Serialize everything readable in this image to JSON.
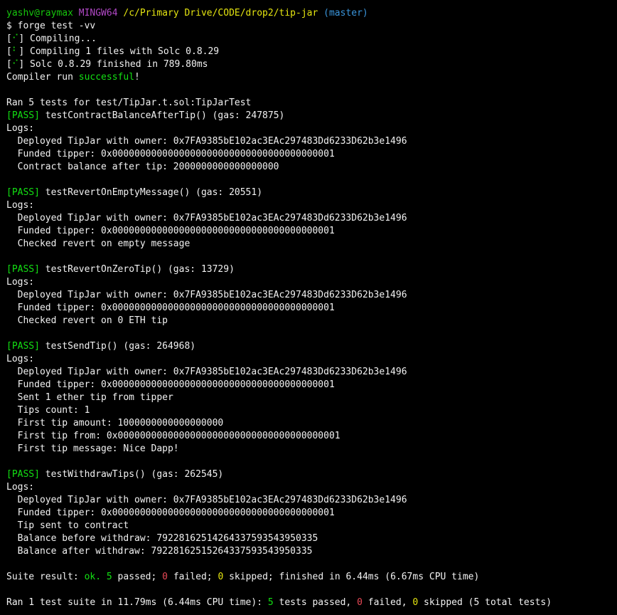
{
  "lines": [
    [
      {
        "t": "yashv@raymax",
        "c": "green"
      },
      {
        "t": " "
      },
      {
        "t": "MINGW64",
        "c": "magenta"
      },
      {
        "t": " "
      },
      {
        "t": "/c/Primary Drive/CODE/drop2/tip-jar",
        "c": "yellow"
      },
      {
        "t": " "
      },
      {
        "t": "(master)",
        "c": "cyan"
      }
    ],
    [
      {
        "t": "$ forge test -vv"
      }
    ],
    [
      {
        "t": "["
      },
      {
        "t": "⠊",
        "c": "green"
      },
      {
        "t": "] Compiling..."
      }
    ],
    [
      {
        "t": "["
      },
      {
        "t": "⠃",
        "c": "green"
      },
      {
        "t": "] Compiling 1 files with Solc 0.8.29"
      }
    ],
    [
      {
        "t": "["
      },
      {
        "t": "⠊",
        "c": "green"
      },
      {
        "t": "] Solc 0.8.29 finished in 789.80ms"
      }
    ],
    [
      {
        "t": "Compiler run "
      },
      {
        "t": "successful",
        "c": "lime"
      },
      {
        "t": "!"
      }
    ],
    [],
    [
      {
        "t": "Ran 5 tests for test/TipJar.t.sol:TipJarTest"
      }
    ],
    [
      {
        "t": "[PASS]",
        "c": "lime"
      },
      {
        "t": " testContractBalanceAfterTip() (gas: 247875)"
      }
    ],
    [
      {
        "t": "Logs:"
      }
    ],
    [
      {
        "t": "  Deployed TipJar with owner: 0x7FA9385bE102ac3EAc297483Dd6233D62b3e1496"
      }
    ],
    [
      {
        "t": "  Funded tipper: 0x0000000000000000000000000000000000000001"
      }
    ],
    [
      {
        "t": "  Contract balance after tip: 2000000000000000000"
      }
    ],
    [],
    [
      {
        "t": "[PASS]",
        "c": "lime"
      },
      {
        "t": " testRevertOnEmptyMessage() (gas: 20551)"
      }
    ],
    [
      {
        "t": "Logs:"
      }
    ],
    [
      {
        "t": "  Deployed TipJar with owner: 0x7FA9385bE102ac3EAc297483Dd6233D62b3e1496"
      }
    ],
    [
      {
        "t": "  Funded tipper: 0x0000000000000000000000000000000000000001"
      }
    ],
    [
      {
        "t": "  Checked revert on empty message"
      }
    ],
    [],
    [
      {
        "t": "[PASS]",
        "c": "lime"
      },
      {
        "t": " testRevertOnZeroTip() (gas: 13729)"
      }
    ],
    [
      {
        "t": "Logs:"
      }
    ],
    [
      {
        "t": "  Deployed TipJar with owner: 0x7FA9385bE102ac3EAc297483Dd6233D62b3e1496"
      }
    ],
    [
      {
        "t": "  Funded tipper: 0x0000000000000000000000000000000000000001"
      }
    ],
    [
      {
        "t": "  Checked revert on 0 ETH tip"
      }
    ],
    [],
    [
      {
        "t": "[PASS]",
        "c": "lime"
      },
      {
        "t": " testSendTip() (gas: 264968)"
      }
    ],
    [
      {
        "t": "Logs:"
      }
    ],
    [
      {
        "t": "  Deployed TipJar with owner: 0x7FA9385bE102ac3EAc297483Dd6233D62b3e1496"
      }
    ],
    [
      {
        "t": "  Funded tipper: 0x0000000000000000000000000000000000000001"
      }
    ],
    [
      {
        "t": "  Sent 1 ether tip from tipper"
      }
    ],
    [
      {
        "t": "  Tips count: 1"
      }
    ],
    [
      {
        "t": "  First tip amount: 1000000000000000000"
      }
    ],
    [
      {
        "t": "  First tip from: 0x0000000000000000000000000000000000000001"
      }
    ],
    [
      {
        "t": "  First tip message: Nice Dapp!"
      }
    ],
    [],
    [
      {
        "t": "[PASS]",
        "c": "lime"
      },
      {
        "t": " testWithdrawTips() (gas: 262545)"
      }
    ],
    [
      {
        "t": "Logs:"
      }
    ],
    [
      {
        "t": "  Deployed TipJar with owner: 0x7FA9385bE102ac3EAc297483Dd6233D62b3e1496"
      }
    ],
    [
      {
        "t": "  Funded tipper: 0x0000000000000000000000000000000000000001"
      }
    ],
    [
      {
        "t": "  Tip sent to contract"
      }
    ],
    [
      {
        "t": "  Balance before withdraw: 79228162514264337593543950335"
      }
    ],
    [
      {
        "t": "  Balance after withdraw: 79228162515264337593543950335"
      }
    ],
    [],
    [
      {
        "t": "Suite result: "
      },
      {
        "t": "ok.",
        "c": "lime"
      },
      {
        "t": " "
      },
      {
        "t": "5",
        "c": "lime"
      },
      {
        "t": " passed; "
      },
      {
        "t": "0",
        "c": "red"
      },
      {
        "t": " failed; "
      },
      {
        "t": "0",
        "c": "yellow"
      },
      {
        "t": " skipped; finished in 6.44ms (6.67ms CPU time)"
      }
    ],
    [],
    [
      {
        "t": "Ran 1 test suite in 11.79ms (6.44ms CPU time): "
      },
      {
        "t": "5",
        "c": "lime"
      },
      {
        "t": " tests passed, "
      },
      {
        "t": "0",
        "c": "red"
      },
      {
        "t": " failed, "
      },
      {
        "t": "0",
        "c": "yellow"
      },
      {
        "t": " skipped (5 total tests)"
      }
    ]
  ],
  "colors": {
    "background": "#000000",
    "foreground": "#f2f2f2",
    "green": "#16c60c",
    "lime": "#13e013",
    "magenta": "#b148c6",
    "yellow": "#e5e510",
    "cyan": "#3a96dd",
    "red": "#e74856"
  }
}
